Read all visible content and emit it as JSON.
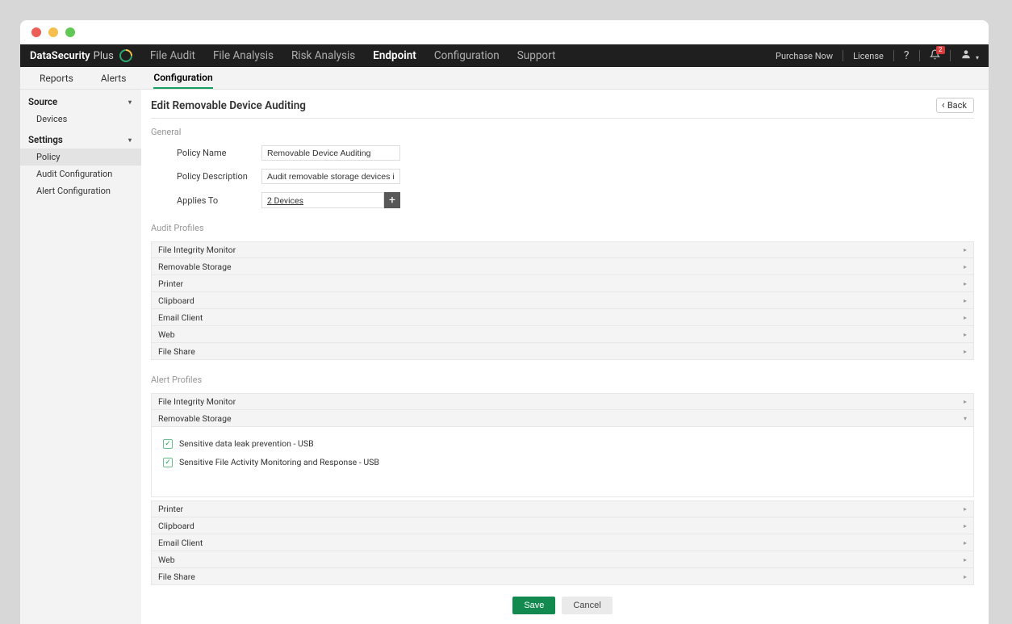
{
  "brand": {
    "name": "DataSecurity",
    "suffix": "Plus"
  },
  "topnav": {
    "items": [
      "File Audit",
      "File Analysis",
      "Risk Analysis",
      "Endpoint",
      "Configuration",
      "Support"
    ],
    "active": "Endpoint",
    "right": {
      "purchase": "Purchase Now",
      "license": "License",
      "notif_count": "2"
    }
  },
  "subnav": {
    "items": [
      "Reports",
      "Alerts",
      "Configuration"
    ],
    "active": "Configuration"
  },
  "sidebar": {
    "groups": [
      {
        "label": "Source",
        "items": [
          "Devices"
        ]
      },
      {
        "label": "Settings",
        "items": [
          "Policy",
          "Audit Configuration",
          "Alert Configuration"
        ]
      }
    ],
    "active": "Policy"
  },
  "page": {
    "title": "Edit Removable Device Auditing",
    "back": "Back",
    "sections": {
      "general": {
        "title": "General",
        "policy_name_label": "Policy Name",
        "policy_name_value": "Removable Device Auditing",
        "policy_desc_label": "Policy Description",
        "policy_desc_value": "Audit removable storage devices including",
        "applies_label": "Applies To",
        "applies_value": "2 Devices"
      },
      "audit": {
        "title": "Audit Profiles",
        "items": [
          "File Integrity Monitor",
          "Removable Storage",
          "Printer",
          "Clipboard",
          "Email Client",
          "Web",
          "File Share"
        ]
      },
      "alert": {
        "title": "Alert Profiles",
        "items_top": [
          "File Integrity Monitor",
          "Removable Storage"
        ],
        "expanded_checks": [
          "Sensitive data leak prevention - USB",
          "Sensitive File Activity Monitoring and Response - USB"
        ],
        "items_bottom": [
          "Printer",
          "Clipboard",
          "Email Client",
          "Web",
          "File Share"
        ]
      }
    },
    "buttons": {
      "save": "Save",
      "cancel": "Cancel"
    }
  }
}
